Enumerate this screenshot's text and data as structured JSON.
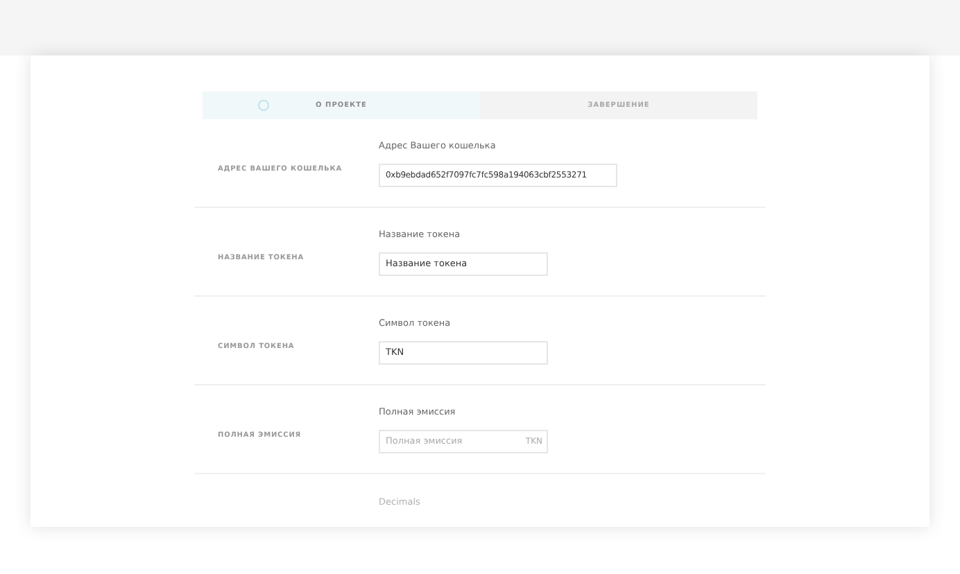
{
  "tabs": [
    {
      "label": "О ПРОЕКТЕ",
      "selected": true
    },
    {
      "label": "ЗАВЕРШЕНИЕ",
      "selected": false
    }
  ],
  "rows": [
    {
      "section": "АДРЕС ВАШЕГО КОШЕЛЬКА",
      "label": "Адрес Вашего кошелька",
      "value": "0xb9ebdad652f7097fc7fc598a194063cbf2553271",
      "wide": true,
      "disabled": false
    },
    {
      "section": "НАЗВАНИЕ ТОКЕНА",
      "label": "Название токена",
      "value": "Название токена",
      "wide": false,
      "disabled": false
    },
    {
      "section": "СИМВОЛ ТОКЕНА",
      "label": "Символ токена",
      "value": "TKN",
      "wide": false,
      "disabled": false
    },
    {
      "section": "ПОЛНАЯ ЭМИССИЯ",
      "label": "Полная эмиссия",
      "placeholder": "Полная эмиссия",
      "suffix": "TKN",
      "wide": false,
      "disabled": false
    },
    {
      "label": "Decimals",
      "disabled": true
    }
  ]
}
